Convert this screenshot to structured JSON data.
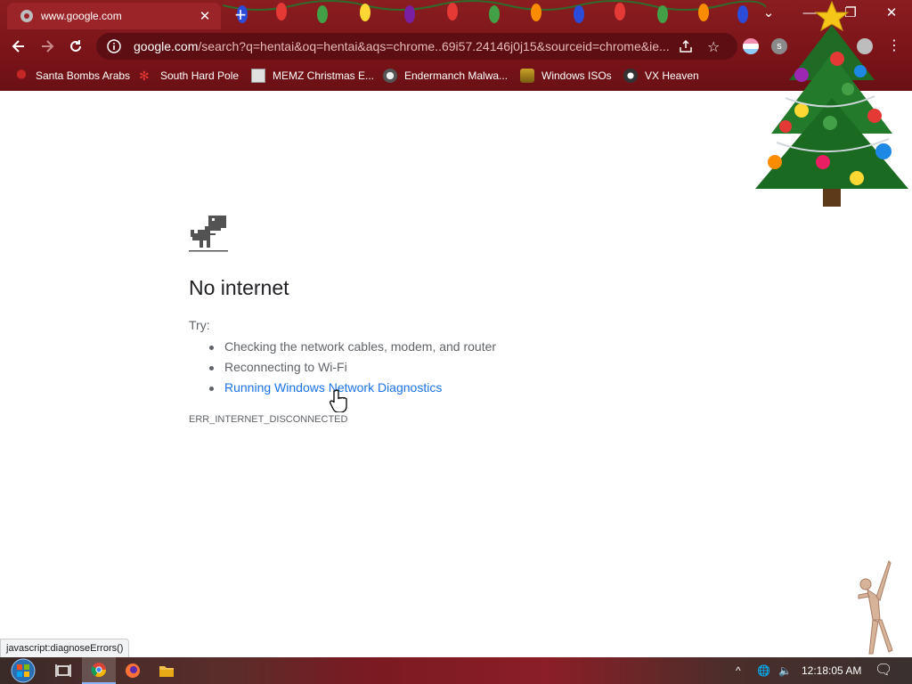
{
  "browser": {
    "tab_title": "www.google.com",
    "url_host": "google.com",
    "url_rest": "/search?q=hentai&oq=hentai&aqs=chrome..69i57.24146j0j15&sourceid=chrome&ie...",
    "extension_letter": "s",
    "bookmarks": [
      {
        "label": "Santa Bombs Arabs"
      },
      {
        "label": "South Hard Pole"
      },
      {
        "label": "MEMZ Christmas E..."
      },
      {
        "label": "Endermanch Malwa..."
      },
      {
        "label": "Windows ISOs"
      },
      {
        "label": "VX Heaven"
      }
    ]
  },
  "page": {
    "title": "No internet",
    "try_label": "Try:",
    "suggestions": [
      {
        "text": "Checking the network cables, modem, and router",
        "is_link": false
      },
      {
        "text": "Reconnecting to Wi-Fi",
        "is_link": false
      },
      {
        "text": "Running Windows Network Diagnostics",
        "is_link": true
      }
    ],
    "error_code": "ERR_INTERNET_DISCONNECTED"
  },
  "status_bar": {
    "text": "javascript:diagnoseErrors()"
  },
  "taskbar": {
    "time": "12:18:05 AM"
  },
  "colors": {
    "chrome_bg": "#7a1418",
    "omnibox_bg": "#5d0e12",
    "link": "#1a73e8",
    "text_secondary": "#5f6368"
  }
}
